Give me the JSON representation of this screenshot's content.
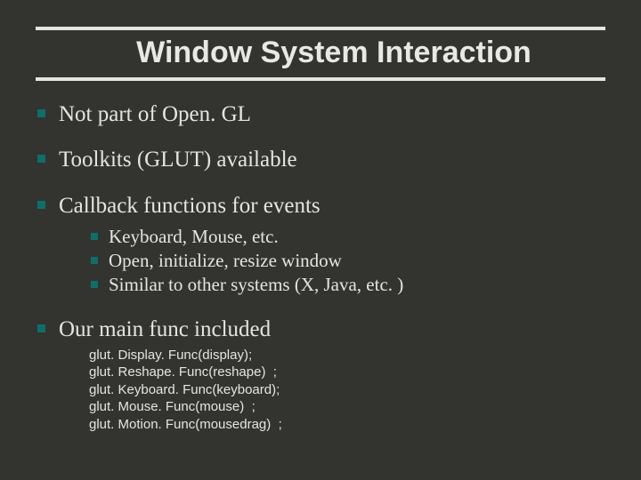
{
  "title": "Window System Interaction",
  "bullets": {
    "b1": "Not part of Open. GL",
    "b2": "Toolkits (GLUT) available",
    "b3": "Callback functions for events",
    "b3_sub": {
      "s1": "Keyboard, Mouse, etc.",
      "s2": "Open, initialize, resize window",
      "s3": "Similar to other systems (X, Java, etc. )"
    },
    "b4": "Our main func included",
    "code": {
      "l1": "glut. Display. Func(display);",
      "l2": "glut. Reshape. Func(reshape)  ;",
      "l3": "glut. Keyboard. Func(keyboard);",
      "l4": "glut. Mouse. Func(mouse)  ;",
      "l5": "glut. Motion. Func(mousedrag)  ;"
    }
  }
}
